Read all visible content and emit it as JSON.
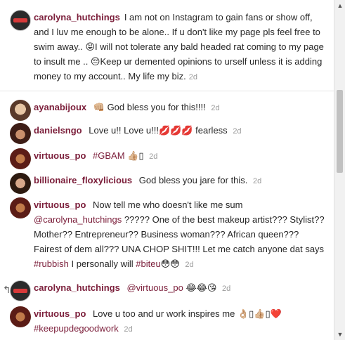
{
  "caption": {
    "username": "carolyna_hutchings",
    "text_1": "I am not on Instagram to gain fans or show off, and I luv me enough to be alone.. If u don't like my page pls feel free to swim away.. ",
    "emoji_1": "😝",
    "text_2": "I will not tolerate any bald headed rat coming to my page to insult me .. ",
    "emoji_2": "😔",
    "text_3": "Keep ur demented opinions to urself unless it is adding money to my account.. My life my biz.",
    "time": "2d"
  },
  "comments": [
    {
      "username": "ayanabijoux",
      "emoji": "👊🏼",
      "text": " God bless you for this!!!!",
      "time": "2d"
    },
    {
      "username": "danielsngo",
      "text": "Love u!! Love u!!!",
      "emoji": "💋💋💋",
      "text2": " fearless",
      "time": "2d"
    },
    {
      "username": "virtuous_po",
      "hashtag": "#GBAM",
      "emoji": "👍🏼▯",
      "time": "2d"
    },
    {
      "username": "billionaire_floxylicious",
      "text": "God bless you jare for this.",
      "time": "2d"
    },
    {
      "username": "virtuous_po",
      "text_1": "Now tell me who doesn't like me sum ",
      "mention": "@carolyna_hutchings",
      "text_2": " ????? One of the best makeup artist??? Stylist?? Mother?? Entrepreneur?? Business woman??? African queen??? Fairest of dem all??? UNA CHOP SHIT!!! Let me catch anyone dat says ",
      "hashtag_1": "#rubbish",
      "text_3": " I personally will ",
      "hashtag_2": "#biteu",
      "emoji": "😳😳",
      "time": "2d"
    },
    {
      "username": "carolyna_hutchings",
      "mention": "@virtuous_po",
      "emoji": "😂😂😘",
      "time": "2d"
    },
    {
      "username": "virtuous_po",
      "text": "Love u too and ur work inspires me",
      "emoji": "👌🏼▯👍🏼▯❤️",
      "hashtag": "#keepupdegoodwork",
      "time": "2d"
    }
  ],
  "scrollbar": {
    "up": "▲",
    "down": "▼"
  }
}
